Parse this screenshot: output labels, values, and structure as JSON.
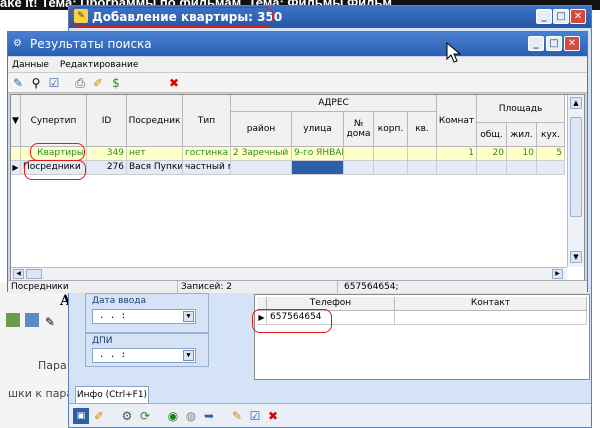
{
  "background": {
    "headline": "ake it! Тема: Программы по фильмам, Тема: Фильмы Фильм",
    "side_texts": [
      "Пара",
      "шки к пара"
    ]
  },
  "outer_window": {
    "title": "Добавление квартиры: 350",
    "filter_labels": {
      "date_label": "Дата ввода",
      "dpi_label": "ДПИ"
    },
    "date_value": ". .    :",
    "dpi_value": ". .    :",
    "contacts": {
      "columns": [
        "Телефон",
        "Контакт"
      ],
      "rows": [
        {
          "phone": "657564654",
          "contact": ""
        }
      ]
    },
    "tab_label": "Инфо (Ctrl+F1)"
  },
  "results_window": {
    "title": "Результаты поиска",
    "menu": [
      "Данные",
      "Редактирование"
    ],
    "grid": {
      "headers": {
        "supertype": "Супертип",
        "id": "ID",
        "agent": "Посредник",
        "type": "Тип",
        "address": "АДРЕС",
        "district": "район",
        "street": "улица",
        "house": "№ дома",
        "building": "корп.",
        "apartment": "кв.",
        "rooms": "Комнат",
        "area": "Площадь",
        "area_total": "общ.",
        "area_living": "жил.",
        "area_kitchen": "кух."
      },
      "rows": [
        {
          "supertype": "Квартиры",
          "id": "349",
          "agent": "нет",
          "type": "гостинка",
          "district": "2 Заречный",
          "street": "9-го ЯНВАР",
          "house": "",
          "building": "",
          "apartment": "",
          "rooms": "1",
          "area_total": "20",
          "area_living": "10",
          "area_kitchen": "5"
        },
        {
          "supertype": "Посредники",
          "id": "276",
          "agent": "Вася Пупкин",
          "type": "частный ма",
          "district": "",
          "street": "",
          "house": "",
          "building": "",
          "apartment": "",
          "rooms": "",
          "area_total": "",
          "area_living": "",
          "area_kitchen": ""
        }
      ]
    },
    "status": {
      "section": "Посредники",
      "records": "Записей: 2",
      "phone": "657564654;"
    }
  },
  "colors": {
    "title_bar": "#2a5fb2",
    "row_highlight": "#ffffcc",
    "annotation": "#e01b1b"
  }
}
